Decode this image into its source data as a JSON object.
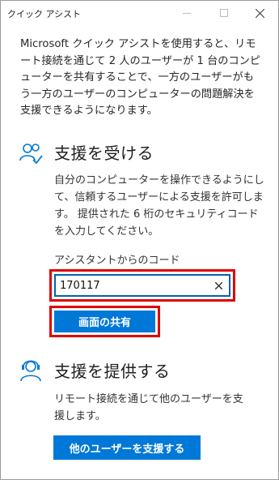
{
  "window": {
    "title": "クイック アシスト"
  },
  "intro": {
    "text": "Microsoft クイック アシストを使用すると、リモート接続を通じて 2 人のユーザーが 1 台のコンピューターを共有することで、一方のユーザーがもう一方のユーザーのコンピューターの問題解決を支援できるようになります。"
  },
  "get_help": {
    "title": "支援を受ける",
    "description": "自分のコンピューターを操作できるようにして、信頼するユーザーによる支援を許可します。 提供された 6 桁のセキュリティコードを入力してください。",
    "code_label": "アシスタントからのコード",
    "code_value": "170117",
    "share_button": "画面の共有"
  },
  "give_help": {
    "title": "支援を提供する",
    "description": "リモート接続を通じて他のユーザーを支援します。",
    "help_button": "他のユーザーを支援する"
  },
  "colors": {
    "accent": "#0078d7",
    "highlight": "#e00000"
  }
}
